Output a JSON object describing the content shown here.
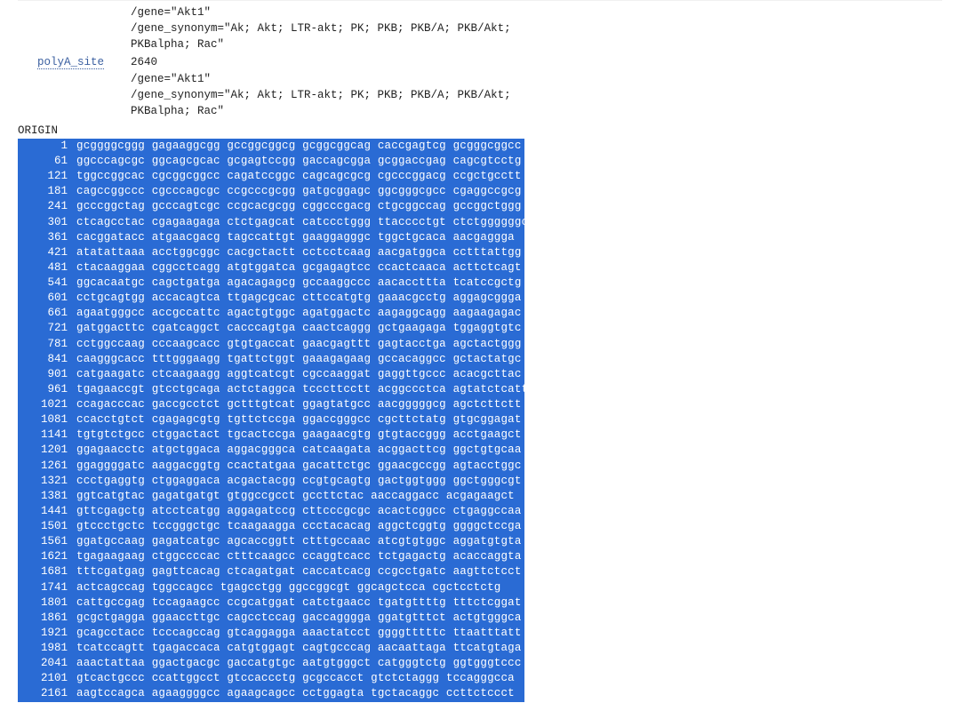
{
  "features": [
    {
      "key": "",
      "lines": [
        "/gene=\"Akt1\"",
        "/gene_synonym=\"Ak; Akt; LTR-akt; PK; PKB; PKB/A; PKB/Akt;",
        "PKBalpha; Rac\""
      ]
    },
    {
      "key": "polyA_site",
      "lines": [
        "2640",
        "/gene=\"Akt1\"",
        "/gene_synonym=\"Ak; Akt; LTR-akt; PK; PKB; PKB/A; PKB/Akt;",
        "PKBalpha; Rac\""
      ]
    }
  ],
  "origin_label": "ORIGIN",
  "sequence": [
    {
      "pos": "1",
      "seq": "gcggggcggg gagaaggcgg gccggcggcg gcggcggcag caccgagtcg gcgggcggcc"
    },
    {
      "pos": "61",
      "seq": "ggcccagcgc ggcagcgcac gcgagtccgg gaccagcgga gcggaccgag cagcgtcctg"
    },
    {
      "pos": "121",
      "seq": "tggccggcac cgcggcggcc cagatccggc cagcagcgcg cgcccggacg ccgctgcctt"
    },
    {
      "pos": "181",
      "seq": "cagccggccc cgcccagcgc ccgcccgcgg gatgcggagc ggcgggcgcc cgaggccgcg"
    },
    {
      "pos": "241",
      "seq": "gcccggctag gcccagtcgc ccgcacgcgg cggcccgacg ctgcggccag gccggctggg"
    },
    {
      "pos": "301",
      "seq": "ctcagcctac cgagaagaga ctctgagcat catccctggg ttacccctgt ctctggggggc"
    },
    {
      "pos": "361",
      "seq": "cacggatacc atgaacgacg tagccattgt gaaggagggc tggctgcaca aacgaggga"
    },
    {
      "pos": "421",
      "seq": "atatattaaa acctggcggc cacgctactt cctcctcaag aacgatggca cctttattgg"
    },
    {
      "pos": "481",
      "seq": "ctacaaggaa cggcctcagg atgtggatca gcgagagtcc ccactcaaca acttctcagt"
    },
    {
      "pos": "541",
      "seq": "ggcacaatgc cagctgatga agacagagcg gccaaggccc aacaccttta tcatccgctg"
    },
    {
      "pos": "601",
      "seq": "cctgcagtgg accacagtca ttgagcgcac cttccatgtg gaaacgcctg aggagcggga"
    },
    {
      "pos": "661",
      "seq": "agaatgggcc accgccattc agactgtggc agatggactc aagaggcagg aagaagagac"
    },
    {
      "pos": "721",
      "seq": "gatggacttc cgatcaggct cacccagtga caactcaggg gctgaagaga tggaggtgtc"
    },
    {
      "pos": "781",
      "seq": "cctggccaag cccaagcacc gtgtgaccat gaacgagttt gagtacctga agctactggg"
    },
    {
      "pos": "841",
      "seq": "caagggcacc tttgggaagg tgattctggt gaaagagaag gccacaggcc gctactatgc"
    },
    {
      "pos": "901",
      "seq": "catgaagatc ctcaagaagg aggtcatcgt cgccaaggat gaggttgccc acacgcttac"
    },
    {
      "pos": "961",
      "seq": "tgagaaccgt gtcctgcaga actctaggca tcccttcctt acggccctca agtatctcatt"
    },
    {
      "pos": "1021",
      "seq": "ccagacccac gaccgcctct gctttgtcat ggagtatgcc aacgggggcg agctcttctt"
    },
    {
      "pos": "1081",
      "seq": "ccacctgtct cgagagcgtg tgttctccga ggaccgggcc cgcttctatg gtgcggagat"
    },
    {
      "pos": "1141",
      "seq": "tgtgtctgcc ctggactact tgcactccga gaagaacgtg gtgtaccggg acctgaagct"
    },
    {
      "pos": "1201",
      "seq": "ggagaacctc atgctggaca aggacgggca catcaagata acggacttcg ggctgtgcaa"
    },
    {
      "pos": "1261",
      "seq": "ggaggggatc aaggacggtg ccactatgaa gacattctgc ggaacgccgg agtacctggc"
    },
    {
      "pos": "1321",
      "seq": "ccctgaggtg ctggaggaca acgactacgg ccgtgcagtg gactggtggg ggctgggcgt"
    },
    {
      "pos": "1381",
      "seq": "ggtcatgtac gagatgatgt gtggccgcct gccttctac aaccaggacc acgagaagct"
    },
    {
      "pos": "1441",
      "seq": "gttcgagctg atcctcatgg aggagatccg cttcccgcgc acactcggcc ctgaggccaa"
    },
    {
      "pos": "1501",
      "seq": "gtccctgctc tccgggctgc tcaagaagga ccctacacag aggctcggtg ggggctccga"
    },
    {
      "pos": "1561",
      "seq": "ggatgccaag gagatcatgc agcaccggtt ctttgccaac atcgtgtggc aggatgtgta"
    },
    {
      "pos": "1621",
      "seq": "tgagaagaag ctggccccac ctttcaagcc ccaggtcacc tctgagactg acaccaggta"
    },
    {
      "pos": "1681",
      "seq": "tttcgatgag gagttcacag ctcagatgat caccatcacg ccgcctgatc aagttctcct"
    },
    {
      "pos": "1741",
      "seq": "actcagccag tggccagcc tgagcctgg ggccggcgt ggcagctcca cgctcctctg"
    },
    {
      "pos": "1801",
      "seq": "cattgccgag tccagaagcc ccgcatggat catctgaacc tgatgttttg tttctcggat"
    },
    {
      "pos": "1861",
      "seq": "gcgctgagga ggaaccttgc cagcctccag gaccagggga ggatgtttct actgtgggca"
    },
    {
      "pos": "1921",
      "seq": "gcagcctacc tcccagccag gtcaggagga aaactatcct ggggtttttc ttaatttatt"
    },
    {
      "pos": "1981",
      "seq": "tcatccagtt tgagaccaca catgtggagt cagtgcccag aacaattaga ttcatgtaga"
    },
    {
      "pos": "2041",
      "seq": "aaactattaa ggactgacgc gaccatgtgc aatgtgggct catgggtctg ggtgggtccc"
    },
    {
      "pos": "2101",
      "seq": "gtcactgccc ccattggcct gtccaccctg gcgccacct gtctctaggg tccagggcca"
    },
    {
      "pos": "2161",
      "seq": "aagtccagca agaaggggcc agaagcagcc cctggagta tgctacaggc ccttctccct"
    }
  ]
}
